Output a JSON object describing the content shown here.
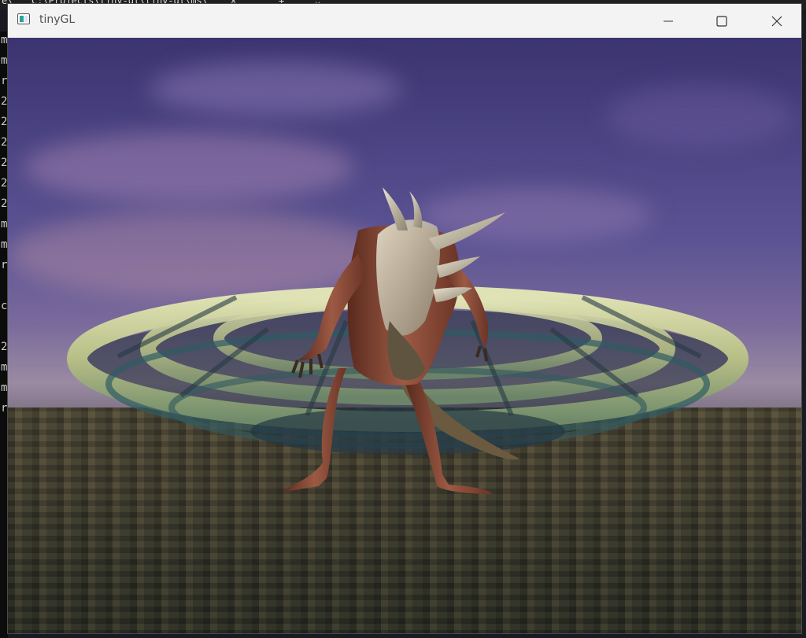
{
  "terminal": {
    "tab_text": "C:\\Projects\\tiny-gl\\tiny-gl\\ms\\",
    "tab_close_glyph": "×",
    "tab_add_glyph": "+",
    "tab_menu_glyph": "⌄",
    "left_column_chars": [
      "m",
      "m",
      "r",
      "2",
      "2",
      "2",
      "2",
      "2",
      "2",
      "m",
      "m",
      "r",
      "",
      "c",
      "",
      "2",
      "m",
      "m",
      "r"
    ]
  },
  "window": {
    "title": "tinyGL",
    "minimize_glyph": "—",
    "maximize_glyph": "☐",
    "close_glyph": "✕"
  },
  "scene": {
    "subject": "creature-model",
    "background": "skybox-city",
    "object": "ring-ship"
  },
  "colors": {
    "titlebar": "#f3f3f3",
    "title_text": "#505050",
    "sky_top": "#3b3470",
    "ring_ship": "#c9cf9a",
    "creature_skin": "#8a4a36"
  }
}
